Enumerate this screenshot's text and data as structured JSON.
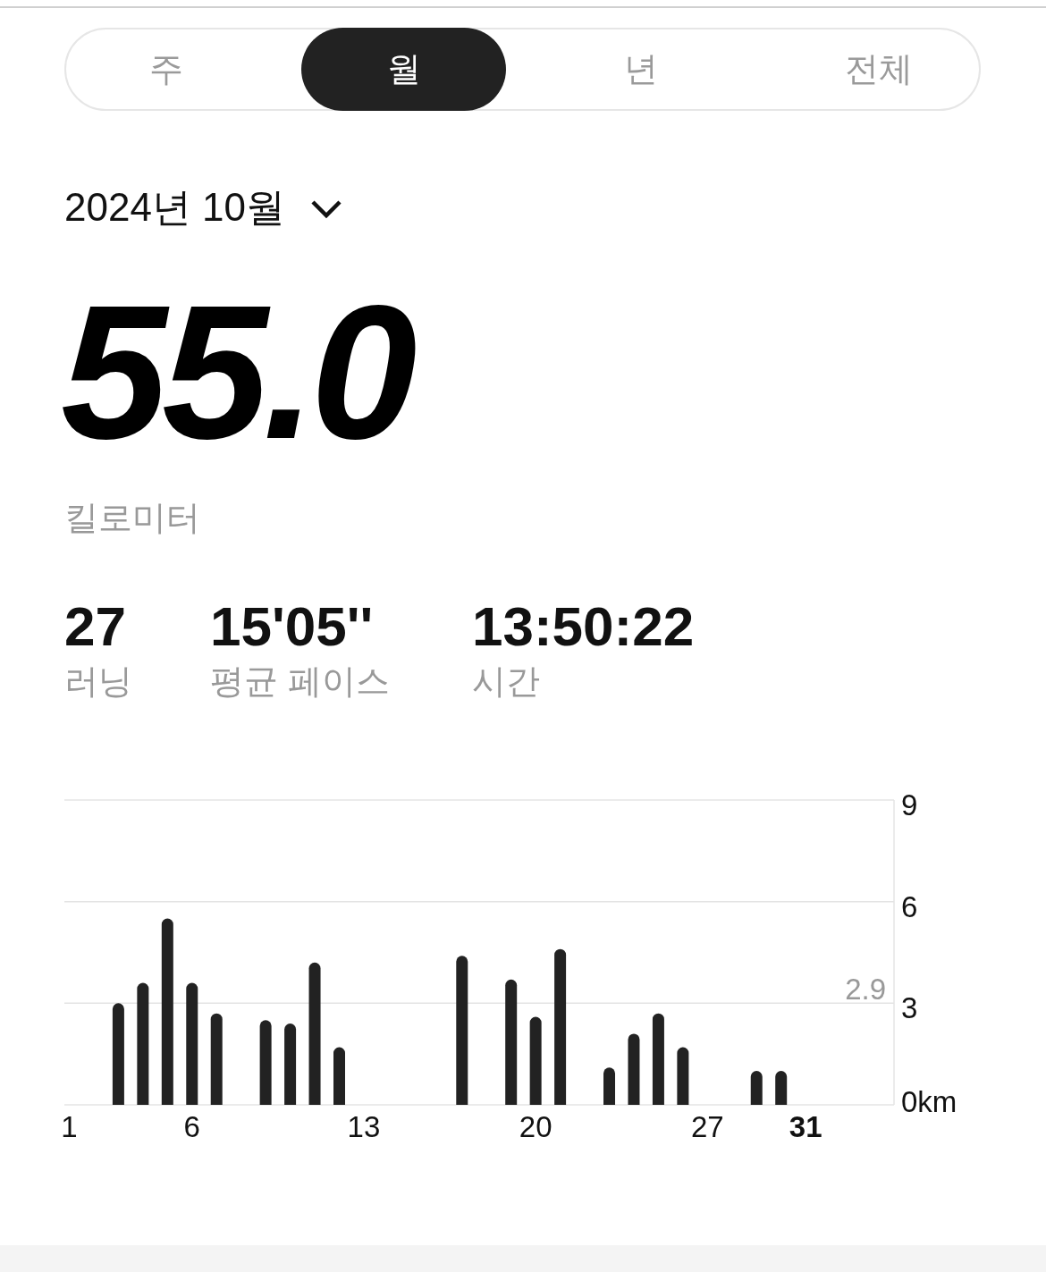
{
  "tabs": [
    {
      "label": "주",
      "selected": false
    },
    {
      "label": "월",
      "selected": true
    },
    {
      "label": "년",
      "selected": false
    },
    {
      "label": "전체",
      "selected": false
    }
  ],
  "period": {
    "label": "2024년 10월"
  },
  "total": {
    "value": "55.0",
    "unit": "킬로미터"
  },
  "stats": [
    {
      "value": "27",
      "label": "러닝"
    },
    {
      "value": "15'05''",
      "label": "평균 페이스"
    },
    {
      "value": "13:50:22",
      "label": "시간"
    }
  ],
  "chart": {
    "chart_data": {
      "type": "bar",
      "x": [
        3,
        4,
        5,
        6,
        7,
        9,
        10,
        11,
        12,
        17,
        19,
        20,
        21,
        23,
        24,
        25,
        26,
        29,
        30
      ],
      "values": [
        3.0,
        3.6,
        5.5,
        3.6,
        2.7,
        2.5,
        2.4,
        4.2,
        1.7,
        4.4,
        3.7,
        2.6,
        4.6,
        1.1,
        2.1,
        2.7,
        1.7,
        1.0,
        1.0
      ],
      "xlim": [
        0.8,
        34.6
      ],
      "ylim": [
        0,
        9
      ],
      "xticks": [
        1,
        6,
        13,
        20,
        27,
        31
      ],
      "yticks": [
        {
          "value": 0,
          "label": "0km"
        },
        3,
        6,
        9
      ],
      "annotations": [
        "2.9"
      ]
    },
    "xtick_bold": [
      false,
      false,
      false,
      false,
      false,
      true
    ]
  }
}
